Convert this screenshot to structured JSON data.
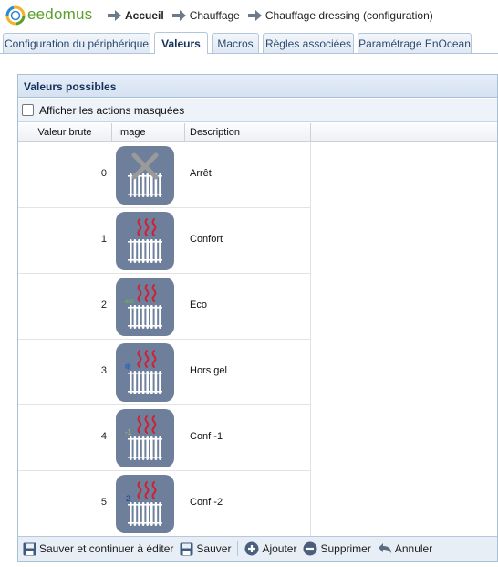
{
  "header": {
    "logo_text": "eedomus",
    "breadcrumb": [
      "Accueil",
      "Chauffage",
      "Chauffage dressing (configuration)"
    ]
  },
  "tabs": [
    {
      "label": "Configuration du périphérique",
      "active": false
    },
    {
      "label": "Valeurs",
      "active": true
    },
    {
      "label": "Macros",
      "active": false
    },
    {
      "label": "Règles associées",
      "active": false
    },
    {
      "label": "Paramétrage EnOcean",
      "active": false
    }
  ],
  "panel": {
    "title": "Valeurs possibles",
    "show_hidden_label": "Afficher les actions masquées",
    "columns": [
      "Valeur brute",
      "Image",
      "Description"
    ]
  },
  "rows": [
    {
      "value": "0",
      "description": "Arrêt",
      "icon": "radiator-off-icon",
      "mark": ""
    },
    {
      "value": "1",
      "description": "Confort",
      "icon": "radiator-confort-icon",
      "mark": ""
    },
    {
      "value": "2",
      "description": "Eco",
      "icon": "radiator-eco-icon",
      "mark": "eco"
    },
    {
      "value": "3",
      "description": "Hors gel",
      "icon": "radiator-frost-icon",
      "mark": "snow"
    },
    {
      "value": "4",
      "description": "Conf -1",
      "icon": "radiator-conf-1-icon",
      "mark": "-1"
    },
    {
      "value": "5",
      "description": "Conf -2",
      "icon": "radiator-conf-2-icon",
      "mark": "-2"
    }
  ],
  "toolbar": {
    "save_continue_label": "Sauver et continuer à éditer",
    "save_label": "Sauver",
    "add_label": "Ajouter",
    "delete_label": "Supprimer",
    "cancel_label": "Annuler"
  },
  "colors": {
    "icon_bg": "#6e7f9c",
    "heat_wave": "#cc2233",
    "brand": "#5aa02c",
    "accent": "#15305a"
  }
}
